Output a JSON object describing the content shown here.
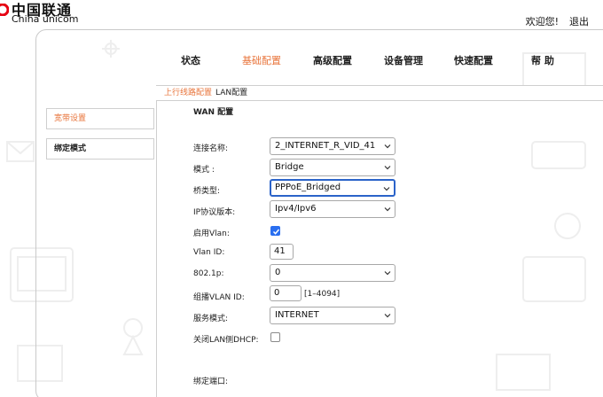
{
  "brand": {
    "name_cn": "中国联通",
    "name_en": "China unicom",
    "color": "#e60012"
  },
  "header": {
    "welcome": "欢迎您!",
    "logout": "退出"
  },
  "nav": {
    "items": [
      {
        "label": "状态"
      },
      {
        "label": "基础配置"
      },
      {
        "label": "高级配置"
      },
      {
        "label": "设备管理"
      },
      {
        "label": "快速配置"
      },
      {
        "label": "帮 助"
      }
    ],
    "active_index": 1
  },
  "breadcrumb": {
    "link": "上行线路配置",
    "current": "LAN配置"
  },
  "sidebar": {
    "items": [
      {
        "label": "宽带设置"
      },
      {
        "label": "绑定模式"
      }
    ]
  },
  "section_title": "WAN 配置",
  "form": {
    "connection_name": {
      "label": "连接名称:",
      "value": "2_INTERNET_R_VID_41"
    },
    "mode": {
      "label": "模式 :",
      "value": "Bridge"
    },
    "bridge_type": {
      "label": "桥类型:",
      "value": "PPPoE_Bridged"
    },
    "ip_version": {
      "label": "IP协议版本:",
      "value": "Ipv4/Ipv6"
    },
    "enable_vlan": {
      "label": "启用Vlan:",
      "checked": true
    },
    "vlan_id": {
      "label": "Vlan ID:",
      "value": "41"
    },
    "dot1p": {
      "label": "802.1p:",
      "value": "0"
    },
    "multicast_vlan": {
      "label": "组播VLAN ID:",
      "value": "0",
      "hint": "[1–4094]"
    },
    "service_mode": {
      "label": "服务模式:",
      "value": "INTERNET"
    },
    "disable_lan_dhcp": {
      "label": "关闭LAN侧DHCP:",
      "checked": false
    },
    "bind_port": {
      "label": "绑定端口:"
    }
  },
  "colors": {
    "accent": "#e8743b",
    "checkbox": "#2a6ff0",
    "focus": "#2b63c9"
  }
}
